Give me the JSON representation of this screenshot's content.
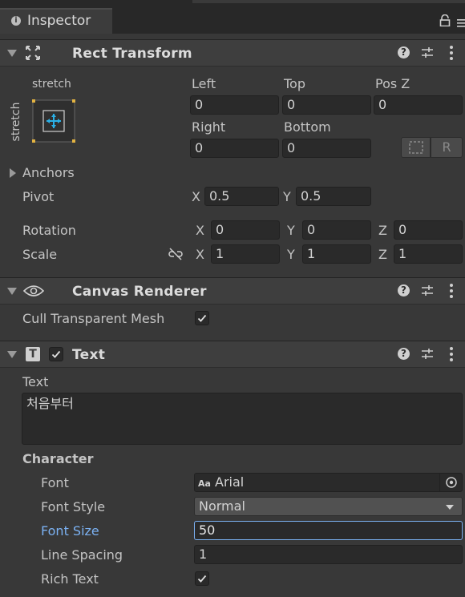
{
  "tab": {
    "title": "Inspector"
  },
  "rect_transform": {
    "title": "Rect Transform",
    "anchor_preset": {
      "top_label": "stretch",
      "side_label": "stretch"
    },
    "left": {
      "label": "Left",
      "value": "0"
    },
    "top": {
      "label": "Top",
      "value": "0"
    },
    "posz": {
      "label": "Pos Z",
      "value": "0"
    },
    "right": {
      "label": "Right",
      "value": "0"
    },
    "bottom": {
      "label": "Bottom",
      "value": "0"
    },
    "raw_button": "R",
    "anchors_label": "Anchors",
    "pivot": {
      "label": "Pivot",
      "x_axis": "X",
      "x": "0.5",
      "y_axis": "Y",
      "y": "0.5"
    },
    "rotation": {
      "label": "Rotation",
      "x_axis": "X",
      "x": "0",
      "y_axis": "Y",
      "y": "0",
      "z_axis": "Z",
      "z": "0"
    },
    "scale": {
      "label": "Scale",
      "x_axis": "X",
      "x": "1",
      "y_axis": "Y",
      "y": "1",
      "z_axis": "Z",
      "z": "1"
    }
  },
  "canvas_renderer": {
    "title": "Canvas Renderer",
    "cull_label": "Cull Transparent Mesh",
    "cull_checked": true
  },
  "text_component": {
    "title": "Text",
    "enabled": true,
    "text_label": "Text",
    "text_value": "처음부터",
    "character_label": "Character",
    "font": {
      "label": "Font",
      "prefix": "Aa",
      "value": "Arial"
    },
    "font_style": {
      "label": "Font Style",
      "value": "Normal"
    },
    "font_size": {
      "label": "Font Size",
      "value": "50"
    },
    "line_spacing": {
      "label": "Line Spacing",
      "value": "1"
    },
    "rich_text": {
      "label": "Rich Text",
      "checked": true
    }
  },
  "colors": {
    "panel_bg": "#383838",
    "header_bg": "#3e3e3e",
    "field_bg": "#2a2a2a",
    "focus_blue": "#7bb1f2",
    "icon_cyan": "#2ab0e6"
  }
}
